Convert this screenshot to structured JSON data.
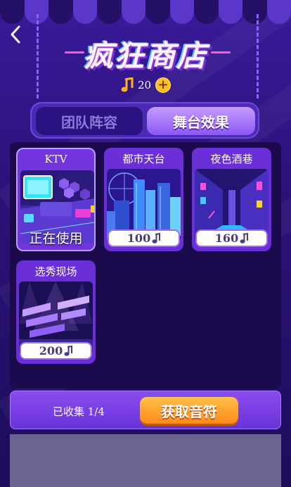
{
  "header": {
    "title": "疯狂商店",
    "coin_count": "20"
  },
  "tabs": [
    {
      "label": "团队阵容",
      "active": false
    },
    {
      "label": "舞台效果",
      "active": true
    }
  ],
  "items": [
    {
      "name": "KTV",
      "status": "正在使用",
      "price": null,
      "selected": true
    },
    {
      "name": "都市天台",
      "status": null,
      "price": "100",
      "selected": false
    },
    {
      "name": "夜色酒巷",
      "status": null,
      "price": "160",
      "selected": false
    },
    {
      "name": "选秀现场",
      "status": null,
      "price": "200",
      "selected": false
    }
  ],
  "footer": {
    "collected": "已收集 1/4",
    "get_button": "获取音符"
  },
  "colors": {
    "accent": "#8d56f5",
    "button": "#ff9a2a",
    "note": "#ffb31a"
  }
}
